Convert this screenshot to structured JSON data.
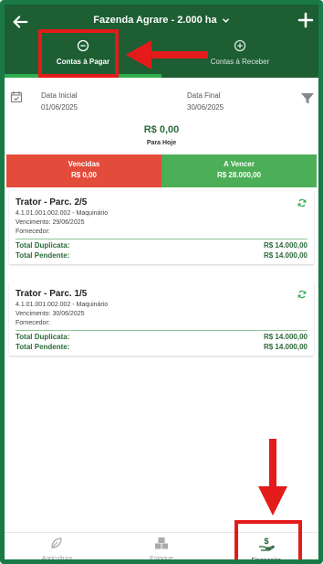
{
  "header": {
    "title": "Fazenda Agrare - 2.000 ha",
    "tabs": [
      {
        "label": "Contas à Pagar",
        "icon": "minus-circle-icon",
        "active": true
      },
      {
        "label": "Contas à Receber",
        "icon": "plus-circle-icon",
        "active": false
      }
    ]
  },
  "filters": {
    "start_label": "Data Inicial",
    "start_value": "01/06/2025",
    "end_label": "Data Final",
    "end_value": "30/06/2025"
  },
  "summary": {
    "today_value": "R$ 0,00",
    "today_label": "Para Hoje",
    "overdue_label": "Vencidas",
    "overdue_value": "R$ 0,00",
    "upcoming_label": "A Vencer",
    "upcoming_value": "R$ 28.000,00"
  },
  "items": [
    {
      "title": "Trator - Parc. 2/5",
      "account": "4.1.01.001.002.002 - Maquinário",
      "due": "Vencimento: 29/06/2025",
      "supplier": "Fornecedor:",
      "total_dup_label": "Total Duplicata:",
      "total_dup_value": "R$ 14.000,00",
      "total_pend_label": "Total Pendente:",
      "total_pend_value": "R$ 14.000,00"
    },
    {
      "title": "Trator  - Parc. 1/5",
      "account": "4.1.01.001.002.002 - Maquinário",
      "due": "Vencimento: 30/06/2025",
      "supplier": "Fornecedor:",
      "total_dup_label": "Total Duplicata:",
      "total_dup_value": "R$ 14.000,00",
      "total_pend_label": "Total Pendente:",
      "total_pend_value": "R$ 14.000,00"
    }
  ],
  "bottom_nav": [
    {
      "label": "Agricultura",
      "icon": "leaf-icon",
      "active": false
    },
    {
      "label": "Estoque",
      "icon": "boxes-icon",
      "active": false
    },
    {
      "label": "Financeiro",
      "icon": "money-hand-icon",
      "active": true
    }
  ],
  "colors": {
    "header_bg": "#1d5e33",
    "accent_green": "#2fae4f",
    "overdue_red": "#e34b3a",
    "upcoming_green": "#4cae57",
    "annotation_red": "#e41b1b"
  }
}
